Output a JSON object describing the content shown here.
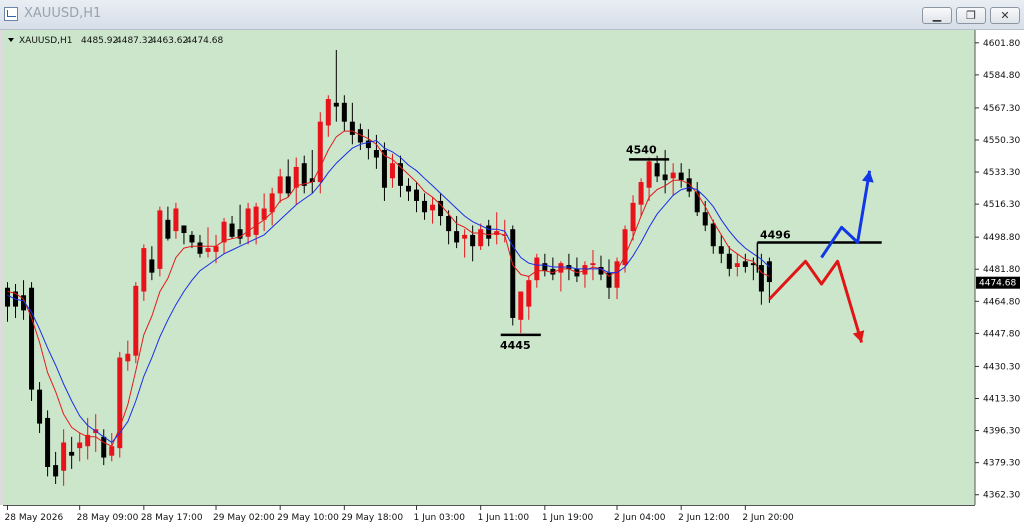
{
  "window": {
    "title": "XAUUSD,H1",
    "icon": "chart-window-icon",
    "buttons": {
      "minimize": "minimize-icon",
      "maximize": "maximize-icon",
      "close": "close-icon"
    }
  },
  "chart_info": {
    "symbol": "XAUUSD,H1",
    "open": "4485.92",
    "high": "4487.32",
    "low": "4463.62",
    "close": "4474.68"
  },
  "colors": {
    "background": "#cce6cc",
    "bull_candle": "#e8121b",
    "bear_candle": "#000000",
    "fast_ma": "#e41a1a",
    "slow_ma": "#1a2ee6",
    "bearish_path": "#e01616",
    "bullish_path": "#1238e6"
  },
  "current_price": "4474.68",
  "chart_data": {
    "type": "candlestick",
    "symbol": "XAUUSD",
    "timeframe": "H1",
    "ylim": [
      4358.0,
      4608.0
    ],
    "y_ticks": [
      "4601.80",
      "4584.80",
      "4567.30",
      "4550.30",
      "4533.30",
      "4516.30",
      "4498.80",
      "4481.80",
      "4464.80",
      "4447.80",
      "4430.30",
      "4413.30",
      "4396.30",
      "4379.30",
      "4362.30"
    ],
    "y_tick_values": [
      4601.8,
      4584.8,
      4567.3,
      4550.3,
      4533.3,
      4516.3,
      4498.8,
      4481.8,
      4464.8,
      4447.8,
      4430.3,
      4413.3,
      4396.3,
      4379.3,
      4362.3
    ],
    "x_ticks": [
      {
        "label": "28 May 2026",
        "index": 0
      },
      {
        "label": "28 May 09:00",
        "index": 9
      },
      {
        "label": "28 May 17:00",
        "index": 17
      },
      {
        "label": "29 May 02:00",
        "index": 26
      },
      {
        "label": "29 May 10:00",
        "index": 34
      },
      {
        "label": "29 May 18:00",
        "index": 42
      },
      {
        "label": "1 Jun 03:00",
        "index": 51
      },
      {
        "label": "1 Jun 11:00",
        "index": 59
      },
      {
        "label": "1 Jun 19:00",
        "index": 67
      },
      {
        "label": "2 Jun 04:00",
        "index": 76
      },
      {
        "label": "2 Jun 12:00",
        "index": 84
      },
      {
        "label": "2 Jun 20:00",
        "index": 92
      }
    ],
    "candles": [
      [
        4472,
        4475,
        4454,
        4462
      ],
      [
        4470,
        4474,
        4456,
        4462
      ],
      [
        4468,
        4476,
        4455,
        4460
      ],
      [
        4472,
        4475,
        4412,
        4418
      ],
      [
        4418,
        4422,
        4395,
        4400
      ],
      [
        4403,
        4407,
        4372,
        4377
      ],
      [
        4378,
        4385,
        4368,
        4372
      ],
      [
        4375,
        4397,
        4367,
        4390
      ],
      [
        4385,
        4393,
        4376,
        4383
      ],
      [
        4387,
        4395,
        4380,
        4390
      ],
      [
        4388,
        4403,
        4381,
        4394
      ],
      [
        4395,
        4405,
        4385,
        4397
      ],
      [
        4393,
        4397,
        4378,
        4382
      ],
      [
        4383,
        4395,
        4380,
        4388
      ],
      [
        4387,
        4438,
        4382,
        4435
      ],
      [
        4433,
        4444,
        4428,
        4437
      ],
      [
        4436,
        4475,
        4432,
        4473
      ],
      [
        4470,
        4495,
        4465,
        4493
      ],
      [
        4487,
        4494,
        4476,
        4480
      ],
      [
        4482,
        4515,
        4478,
        4513
      ],
      [
        4508,
        4515,
        4497,
        4498
      ],
      [
        4502,
        4517,
        4498,
        4514
      ],
      [
        4505,
        4504,
        4495,
        4501
      ],
      [
        4500,
        4502,
        4493,
        4496
      ],
      [
        4496,
        4500,
        4488,
        4490
      ],
      [
        4491,
        4504,
        4488,
        4493
      ],
      [
        4491,
        4500,
        4485,
        4494
      ],
      [
        4496,
        4509,
        4490,
        4507
      ],
      [
        4506,
        4510,
        4498,
        4499
      ],
      [
        4503,
        4516,
        4495,
        4498
      ],
      [
        4499,
        4517,
        4495,
        4514
      ],
      [
        4500,
        4517,
        4495,
        4515
      ],
      [
        4508,
        4522,
        4502,
        4514
      ],
      [
        4512,
        4525,
        4505,
        4522
      ],
      [
        4522,
        4535,
        4517,
        4531
      ],
      [
        4531,
        4540,
        4520,
        4522
      ],
      [
        4525,
        4541,
        4516,
        4536
      ],
      [
        4538,
        4542,
        4522,
        4526
      ],
      [
        4530,
        4545,
        4522,
        4528
      ],
      [
        4528,
        4565,
        4522,
        4560
      ],
      [
        4558,
        4574,
        4552,
        4572
      ],
      [
        4570,
        4598,
        4560,
        4568
      ],
      [
        4570,
        4574,
        4555,
        4560
      ],
      [
        4560,
        4570,
        4548,
        4553
      ],
      [
        4556,
        4559,
        4545,
        4549
      ],
      [
        4550,
        4556,
        4540,
        4546
      ],
      [
        4545,
        4553,
        4535,
        4541
      ],
      [
        4545,
        4549,
        4518,
        4525
      ],
      [
        4530,
        4543,
        4525,
        4538
      ],
      [
        4538,
        4542,
        4520,
        4526
      ],
      [
        4526,
        4530,
        4518,
        4523
      ],
      [
        4524,
        4528,
        4512,
        4518
      ],
      [
        4518,
        4522,
        4508,
        4512
      ],
      [
        4513,
        4520,
        4506,
        4516
      ],
      [
        4518,
        4522,
        4505,
        4510
      ],
      [
        4510,
        4513,
        4495,
        4502
      ],
      [
        4502,
        4510,
        4493,
        4496
      ],
      [
        4498,
        4503,
        4488,
        4500
      ],
      [
        4500,
        4505,
        4486,
        4494
      ],
      [
        4494,
        4506,
        4492,
        4503
      ],
      [
        4505,
        4508,
        4494,
        4498
      ],
      [
        4500,
        4512,
        4495,
        4502
      ],
      [
        4500,
        4508,
        4496,
        4500
      ],
      [
        4503,
        4505,
        4452,
        4456
      ],
      [
        4455,
        4462,
        4448,
        4470
      ],
      [
        4462,
        4478,
        4455,
        4476
      ],
      [
        4476,
        4490,
        4472,
        4488
      ],
      [
        4485,
        4490,
        4478,
        4481
      ],
      [
        4482,
        4488,
        4476,
        4479
      ],
      [
        4480,
        4486,
        4470,
        4485
      ],
      [
        4484,
        4490,
        4476,
        4482
      ],
      [
        4482,
        4488,
        4475,
        4478
      ],
      [
        4479,
        4486,
        4472,
        4484
      ],
      [
        4484,
        4492,
        4476,
        4485
      ],
      [
        4483,
        4489,
        4476,
        4479
      ],
      [
        4480,
        4487,
        4466,
        4472
      ],
      [
        4472,
        4488,
        4466,
        4486
      ],
      [
        4484,
        4505,
        4480,
        4503
      ],
      [
        4502,
        4521,
        4497,
        4517
      ],
      [
        4516,
        4530,
        4510,
        4528
      ],
      [
        4525,
        4541,
        4518,
        4539
      ],
      [
        4538,
        4542,
        4528,
        4531
      ],
      [
        4532,
        4545,
        4522,
        4529
      ],
      [
        4530,
        4538,
        4521,
        4533
      ],
      [
        4533,
        4538,
        4525,
        4529
      ],
      [
        4530,
        4535,
        4520,
        4523
      ],
      [
        4523,
        4528,
        4510,
        4512
      ],
      [
        4512,
        4518,
        4502,
        4505
      ],
      [
        4506,
        4508,
        4490,
        4494
      ],
      [
        4494,
        4500,
        4485,
        4490
      ],
      [
        4490,
        4494,
        4478,
        4482
      ],
      [
        4483,
        4490,
        4478,
        4485
      ],
      [
        4486,
        4490,
        4480,
        4483
      ],
      [
        4485,
        4488,
        4476,
        4484
      ],
      [
        4484,
        4490,
        4463,
        4470
      ],
      [
        4486,
        4488,
        4464,
        4475
      ]
    ],
    "series": [
      {
        "name": "",
        "type": "line",
        "values": [
          4470,
          4469,
          4466,
          4456,
          4443,
          4427,
          4417,
          4405,
          4398,
          4395,
          4393,
          4393,
          4390,
          4388,
          4398,
          4410,
          4428,
          4447,
          4457,
          4470,
          4477,
          4488,
          4493,
          4494,
          4494,
          4494,
          4494,
          4497,
          4498,
          4499,
          4502,
          4505,
          4508,
          4512,
          4518,
          4520,
          4526,
          4527,
          4528,
          4536,
          4545,
          4552,
          4555,
          4555,
          4553,
          4551,
          4548,
          4542,
          4540,
          4536,
          4532,
          4528,
          4523,
          4520,
          4516,
          4511,
          4506,
          4504,
          4501,
          4501,
          4500,
          4501,
          4500,
          4484,
          4479,
          4478,
          4481,
          4481,
          4480,
          4482,
          4482,
          4480,
          4481,
          4483,
          4482,
          4478,
          4481,
          4489,
          4499,
          4510,
          4520,
          4524,
          4526,
          4529,
          4529,
          4527,
          4522,
          4515,
          4507,
          4500,
          4493,
          4490,
          4487,
          4486,
          4480,
          4478
        ]
      },
      {
        "name": "",
        "type": "line",
        "values": [
          4468,
          4466,
          4465,
          4459,
          4450,
          4440,
          4431,
          4421,
          4412,
          4404,
          4399,
          4396,
          4393,
          4390,
          4395,
          4401,
          4412,
          4425,
          4435,
          4446,
          4455,
          4463,
          4470,
          4476,
          4481,
          4484,
          4487,
          4490,
          4492,
          4494,
          4496,
          4498,
          4500,
          4504,
          4508,
          4512,
          4516,
          4519,
          4522,
          4527,
          4533,
          4538,
          4542,
          4546,
          4548,
          4549,
          4550,
          4546,
          4544,
          4541,
          4537,
          4534,
          4530,
          4526,
          4522,
          4518,
          4514,
          4510,
          4507,
          4505,
          4503,
          4503,
          4502,
          4494,
          4488,
          4485,
          4484,
          4484,
          4483,
          4483,
          4483,
          4482,
          4482,
          4482,
          4482,
          4480,
          4480,
          4483,
          4489,
          4496,
          4504,
          4511,
          4516,
          4521,
          4524,
          4525,
          4524,
          4520,
          4515,
          4508,
          4502,
          4497,
          4493,
          4490,
          4487,
          4483
        ]
      }
    ],
    "annotations": [
      {
        "text": "4540",
        "price": 4540
      },
      {
        "text": "4445",
        "price": 4447
      },
      {
        "text": "4496",
        "price": 4496
      }
    ],
    "scenarios": [
      {
        "direction": "down",
        "prices": [
          4466,
          4486,
          4474,
          4486,
          4443
        ]
      },
      {
        "direction": "up",
        "prices": [
          4488,
          4504,
          4496,
          4534
        ]
      }
    ]
  }
}
